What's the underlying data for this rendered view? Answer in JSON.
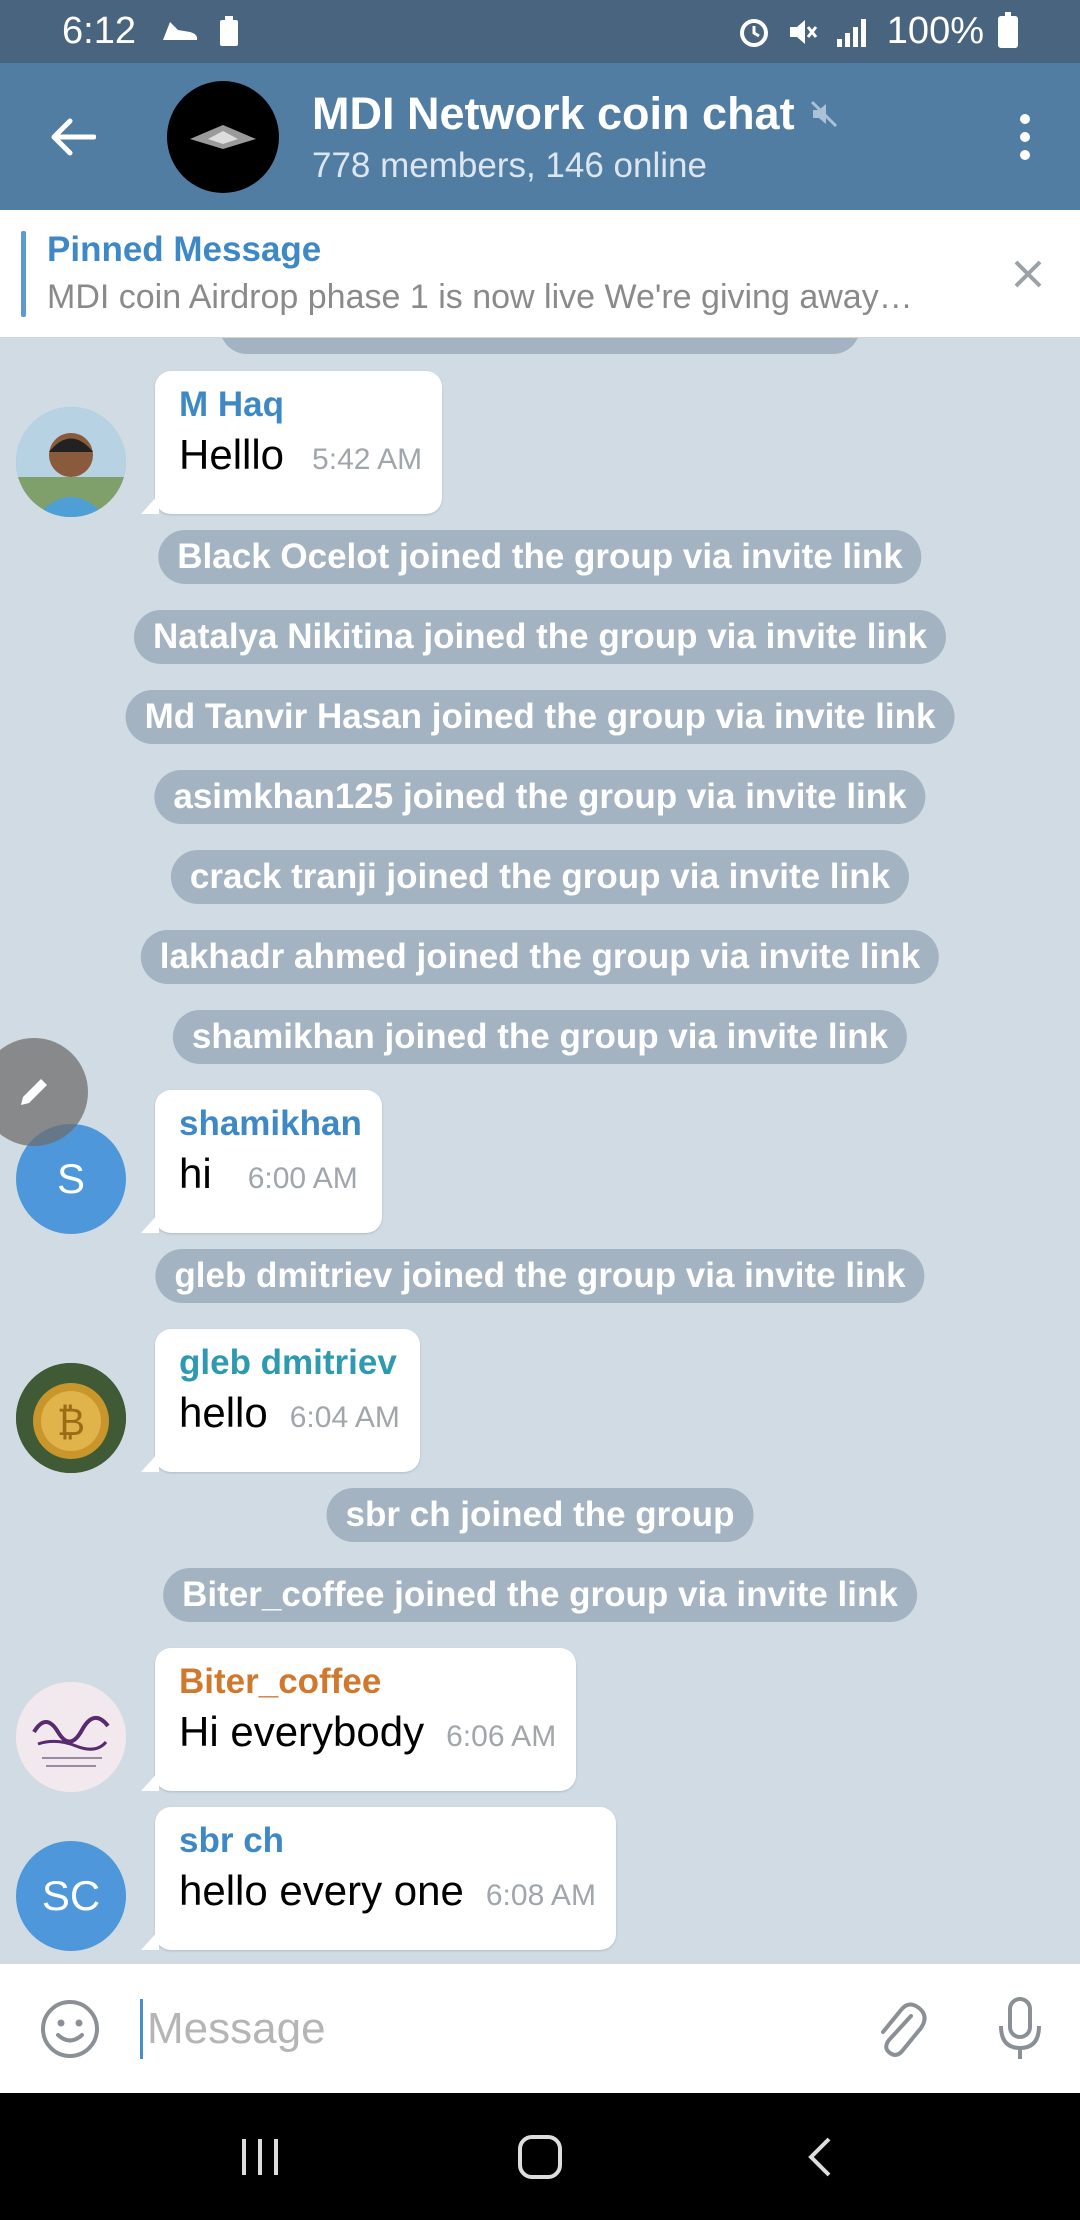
{
  "status_bar": {
    "time": "6:12",
    "battery_percent": "100%",
    "left_icons": [
      "shoe-icon",
      "battery-saver-icon"
    ],
    "right_icons": [
      "alarm-icon",
      "mute-icon",
      "lte-signal-icon",
      "battery-icon"
    ]
  },
  "header": {
    "title": "MDI Network coin chat",
    "subtitle": "778 members, 146 online",
    "muted": true
  },
  "pinned": {
    "title": "Pinned Message",
    "text": "MDI coin Airdrop phase 1 is now live We're giving away…"
  },
  "messages": [
    {
      "type": "bubble",
      "sender": "M Haq",
      "sender_color": "#3e88c6",
      "text": "Helllo",
      "time": "5:42 AM",
      "avatar": "photo-man"
    },
    {
      "type": "service",
      "text": "Black Ocelot joined the group via invite link"
    },
    {
      "type": "service",
      "text": "Natalya Nikitina joined the group via invite link"
    },
    {
      "type": "service",
      "text": "Md Tanvir Hasan joined the group via invite link"
    },
    {
      "type": "service",
      "text": "asimkhan125 joined the group via invite link"
    },
    {
      "type": "service",
      "text": "crack tranji joined the group via invite link"
    },
    {
      "type": "service",
      "text": "lakhadr ahmed joined the group via invite link"
    },
    {
      "type": "service",
      "text": "shamikhan joined the group via invite link"
    },
    {
      "type": "bubble",
      "sender": "shamikhan",
      "sender_color": "#3e88c6",
      "text": "hi",
      "time": "6:00 AM",
      "avatar_initials": "S",
      "avatar_color": "#4d97da"
    },
    {
      "type": "service",
      "text": "gleb dmitriev joined the group via invite link"
    },
    {
      "type": "bubble",
      "sender": "gleb dmitriev",
      "sender_color": "#2e9ab0",
      "text": "hello",
      "time": "6:04 AM",
      "avatar": "photo-bitcoin"
    },
    {
      "type": "service",
      "text": "sbr ch joined the group"
    },
    {
      "type": "service",
      "text": "Biter_coffee joined the group via invite link"
    },
    {
      "type": "bubble",
      "sender": "Biter_coffee",
      "sender_color": "#d0782d",
      "text": "Hi everybody",
      "time": "6:06 AM",
      "avatar": "photo-calligraphy"
    },
    {
      "type": "bubble",
      "sender": "sbr ch",
      "sender_color": "#3e88c6",
      "text": "hello every one",
      "time": "6:08 AM",
      "avatar_initials": "SC",
      "avatar_color": "#4d97da"
    }
  ],
  "input": {
    "placeholder": "Message"
  },
  "colors": {
    "header_bg": "#527da3",
    "status_bg": "#49647f",
    "chat_bg": "#d1dbe4",
    "accent": "#3e88c6"
  }
}
